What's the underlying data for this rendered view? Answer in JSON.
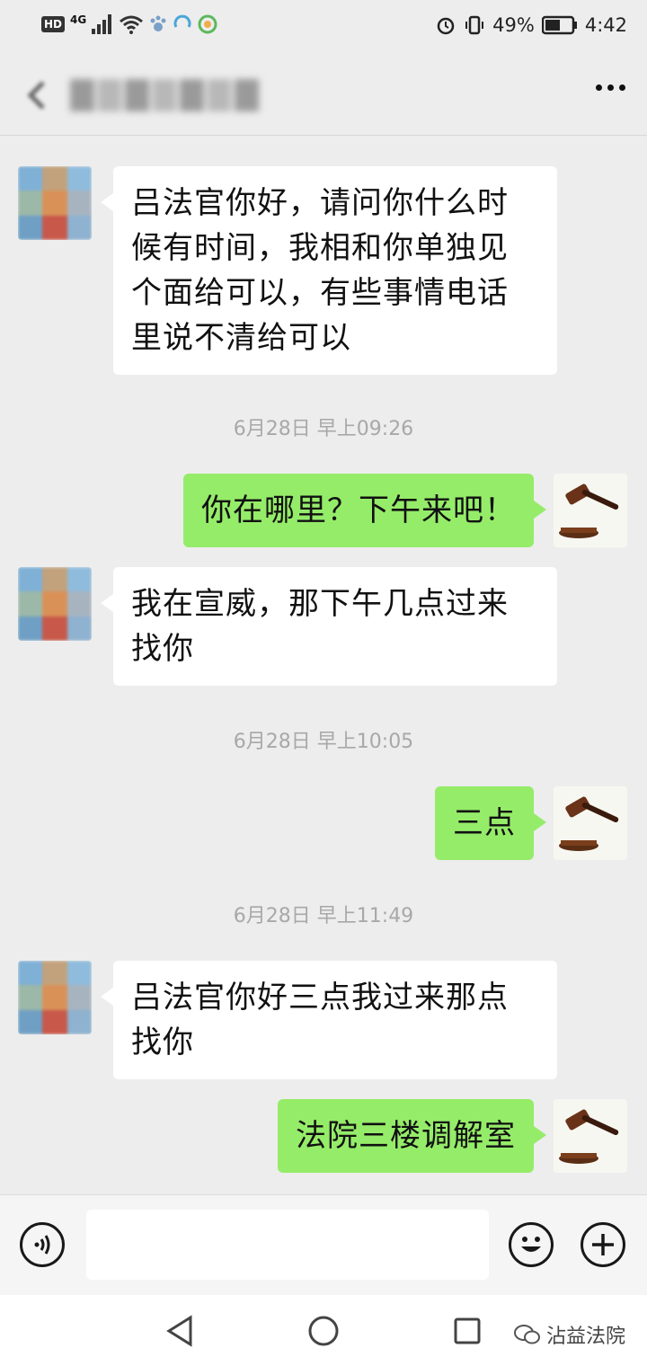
{
  "status_bar": {
    "network_badge": "HD",
    "network_type": "4G",
    "battery_percent": "49%",
    "time": "4:42",
    "icons": [
      "signal-icon",
      "wifi-icon",
      "paw-icon",
      "sync-icon",
      "browser-icon",
      "alarm-icon",
      "vibrate-icon",
      "battery-icon"
    ]
  },
  "nav": {
    "back_icon": "back-chevron-icon",
    "more_icon": "more-dots-icon"
  },
  "messages": [
    {
      "type": "received",
      "text": "吕法官你好，请问你什么时候有时间，我相和你单独见个面给可以，有些事情电话里说不清给可以"
    },
    {
      "type": "timestamp",
      "text": "6月28日 早上09:26"
    },
    {
      "type": "sent",
      "text": "你在哪里？下午来吧！"
    },
    {
      "type": "received",
      "text": "我在宣威，那下午几点过来找你"
    },
    {
      "type": "timestamp",
      "text": "6月28日 早上10:05"
    },
    {
      "type": "sent",
      "text": "三点"
    },
    {
      "type": "timestamp",
      "text": "6月28日 早上11:49"
    },
    {
      "type": "received",
      "text": "吕法官你好三点我过来那点找你"
    },
    {
      "type": "sent",
      "text": "法院三楼调解室"
    }
  ],
  "input_bar": {
    "voice_icon": "voice-icon",
    "message_value": "",
    "emoji_icon": "emoji-icon",
    "plus_icon": "plus-icon"
  },
  "watermark": {
    "text": "沾益法院"
  },
  "colors": {
    "background": "#ededed",
    "sent_bubble": "#95ec69",
    "received_bubble": "#ffffff",
    "timestamp_text": "#a8a8a8"
  }
}
